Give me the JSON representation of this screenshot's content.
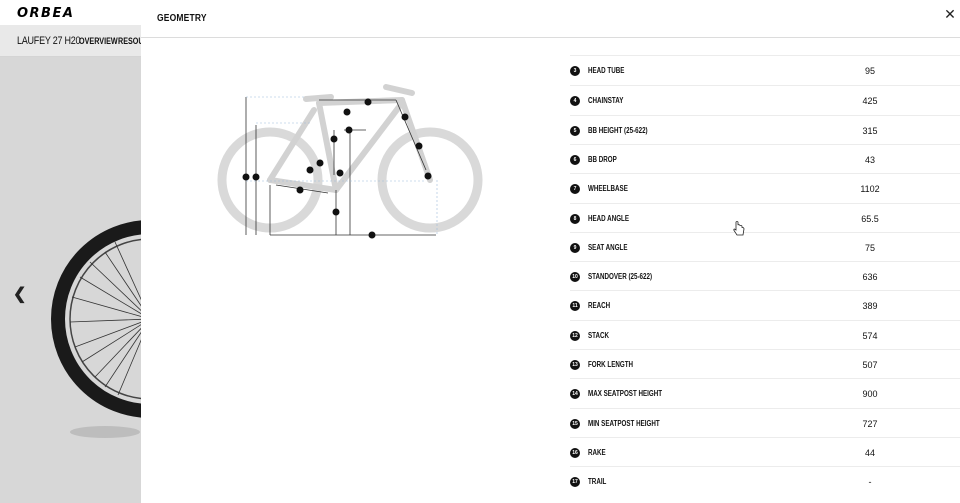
{
  "background": {
    "logo": "ORBEA",
    "model_name": "LAUFEY 27 H20",
    "nav": [
      "OVERVIEW",
      "RESOUR"
    ],
    "prev_icon": "chevron-left-icon"
  },
  "modal": {
    "title": "GEOMETRY",
    "close_icon": "close-icon"
  },
  "geometry": [
    {
      "num": "3",
      "label": "HEAD TUBE",
      "value": "95"
    },
    {
      "num": "4",
      "label": "CHAINSTAY",
      "value": "425"
    },
    {
      "num": "5",
      "label": "BB HEIGHT (25-622)",
      "value": "315"
    },
    {
      "num": "6",
      "label": "BB DROP",
      "value": "43"
    },
    {
      "num": "7",
      "label": "WHEELBASE",
      "value": "1102"
    },
    {
      "num": "8",
      "label": "HEAD ANGLE",
      "value": "65.5"
    },
    {
      "num": "9",
      "label": "SEAT ANGLE",
      "value": "75"
    },
    {
      "num": "10",
      "label": "STANDOVER (25-622)",
      "value": "636"
    },
    {
      "num": "11",
      "label": "REACH",
      "value": "389"
    },
    {
      "num": "12",
      "label": "STACK",
      "value": "574"
    },
    {
      "num": "13",
      "label": "FORK LENGTH",
      "value": "507"
    },
    {
      "num": "14",
      "label": "MAX SEATPOST HEIGHT",
      "value": "900"
    },
    {
      "num": "15",
      "label": "MIN SEATPOST HEIGHT",
      "value": "727"
    },
    {
      "num": "16",
      "label": "RAKE",
      "value": "44"
    },
    {
      "num": "17",
      "label": "TRAIL",
      "value": "-"
    }
  ],
  "diagram_labels": [
    "1",
    "2",
    "3",
    "4",
    "5",
    "6",
    "7",
    "8",
    "9",
    "10",
    "11",
    "12",
    "13",
    "14",
    "15"
  ]
}
